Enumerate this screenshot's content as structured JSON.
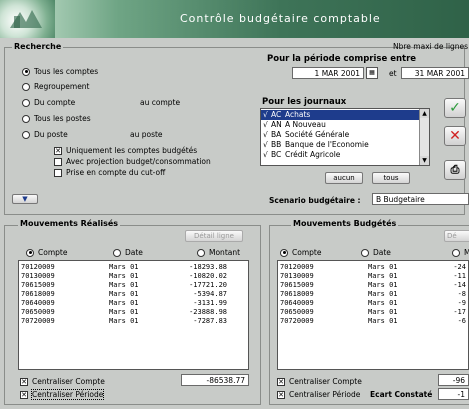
{
  "header": {
    "title": "Contrôle budgétaire comptable"
  },
  "recherche": {
    "title": "Recherche",
    "options": [
      {
        "label": "Tous les comptes",
        "selected": true
      },
      {
        "label": "Regroupement",
        "selected": false
      },
      {
        "label": "Du compte",
        "selected": false,
        "suffix": "au compte"
      },
      {
        "label": "Tous les postes",
        "selected": false
      },
      {
        "label": "Du poste",
        "selected": false,
        "suffix": "au poste"
      }
    ],
    "checks": [
      {
        "label": "Uniquement les comptes budgétés",
        "checked": true
      },
      {
        "label": "Avec projection budget/consommation",
        "checked": false
      },
      {
        "label": "Prise en compte du cut-off",
        "checked": false
      }
    ],
    "max_lines_label": "Nbre maxi de lignes"
  },
  "periode": {
    "label": "Pour la période comprise entre",
    "start": "1 MAR 2001",
    "and": "et",
    "end": "31 MAR 2001"
  },
  "journaux": {
    "label": "Pour les journaux",
    "items": [
      {
        "check": "√",
        "code": "AC",
        "name": "Achats",
        "selected": true
      },
      {
        "check": "√",
        "code": "AN",
        "name": "A Nouveau",
        "selected": false
      },
      {
        "check": "√",
        "code": "BA",
        "name": "Société Générale",
        "selected": false
      },
      {
        "check": "√",
        "code": "BB",
        "name": "Banque de l'Economie",
        "selected": false
      },
      {
        "check": "√",
        "code": "BC",
        "name": "Crédit Agricole",
        "selected": false
      }
    ],
    "none_button": "aucun",
    "all_button": "tous"
  },
  "scenario": {
    "label": "Scenario budgétaire :",
    "value": "B Budgetaire"
  },
  "realises": {
    "title": "Mouvements Réalisés",
    "detail_button": "Détail ligne",
    "sort_options": [
      {
        "label": "Compte",
        "selected": true
      },
      {
        "label": "Date",
        "selected": false
      },
      {
        "label": "Montant",
        "selected": false
      }
    ],
    "rows": [
      {
        "compte": "70120009",
        "date": "Mars 01",
        "montant": "-18293.88"
      },
      {
        "compte": "70130009",
        "date": "Mars 01",
        "montant": "-10820.02"
      },
      {
        "compte": "70615009",
        "date": "Mars 01",
        "montant": "-17721.20"
      },
      {
        "compte": "70618009",
        "date": "Mars 01",
        "montant": "-5394.87"
      },
      {
        "compte": "70640009",
        "date": "Mars 01",
        "montant": "-3131.99"
      },
      {
        "compte": "70650009",
        "date": "Mars 01",
        "montant": "-23888.98"
      },
      {
        "compte": "70720009",
        "date": "Mars 01",
        "montant": "-7287.83"
      }
    ],
    "centraliser_compte": {
      "label": "Centraliser Compte",
      "checked": true
    },
    "centraliser_periode": {
      "label": "Centraliser Période",
      "checked": true
    },
    "total": "-86538.77"
  },
  "budgetes": {
    "title": "Mouvements Budgétés",
    "detail_button": "Dé",
    "sort_options": [
      {
        "label": "Compte",
        "selected": true
      },
      {
        "label": "Date",
        "selected": false
      },
      {
        "label": "M",
        "selected": false
      }
    ],
    "rows": [
      {
        "compte": "70120009",
        "date": "Mars 01",
        "montant": "-24"
      },
      {
        "compte": "70130009",
        "date": "Mars 01",
        "montant": "-11"
      },
      {
        "compte": "70615009",
        "date": "Mars 01",
        "montant": "-14"
      },
      {
        "compte": "70618009",
        "date": "Mars 01",
        "montant": "-8"
      },
      {
        "compte": "70640009",
        "date": "Mars 01",
        "montant": "-9"
      },
      {
        "compte": "70650009",
        "date": "Mars 01",
        "montant": "-17"
      },
      {
        "compte": "70720009",
        "date": "Mars 01",
        "montant": "-6"
      }
    ],
    "centraliser_compte": {
      "label": "Centraliser Compte",
      "checked": true
    },
    "centraliser_periode": {
      "label": "Centraliser Période",
      "checked": true
    },
    "ecart_label": "Ecart Constaté",
    "total": "-96",
    "ecart": "-1"
  },
  "colors": {
    "selection": "#1e3c8c",
    "ok": "#2a9a3a",
    "cancel": "#d02020"
  }
}
